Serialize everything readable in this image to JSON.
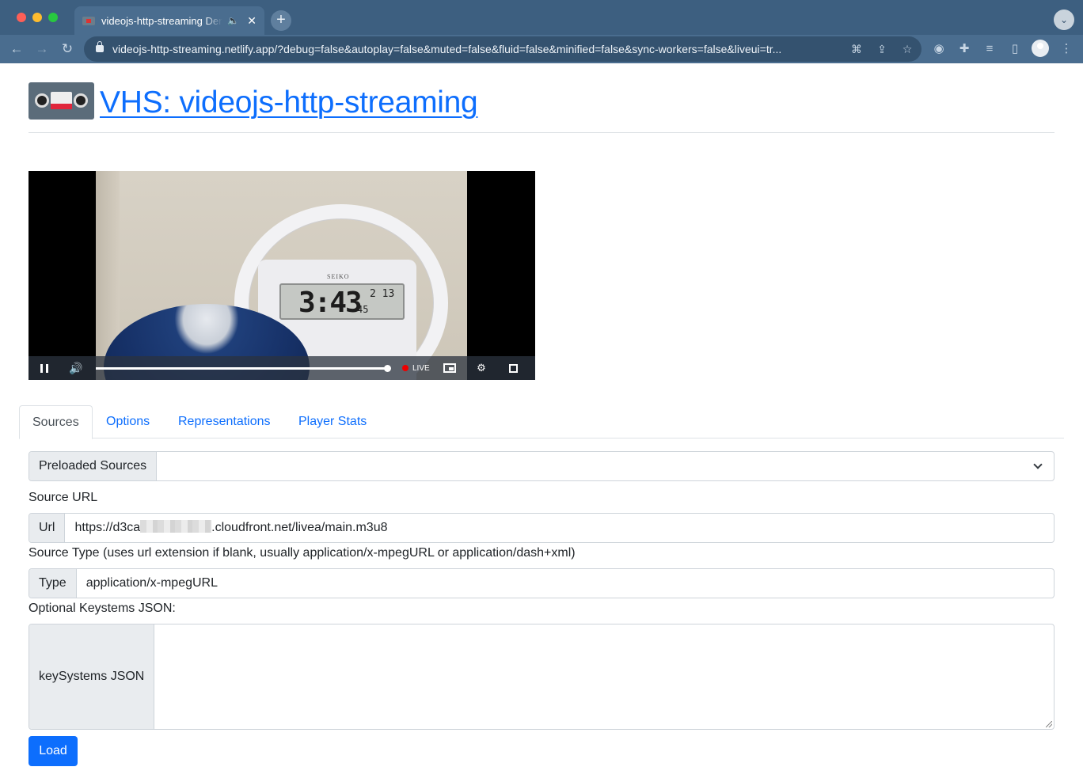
{
  "browser": {
    "tab_title": "videojs-http-streaming Demo",
    "tab_audio_icon": "speaker-icon",
    "tab_close_icon": "close-icon",
    "new_tab_icon": "plus-icon",
    "tab_menu_icon": "chevron-down-icon",
    "url": "videojs-http-streaming.netlify.app/?debug=false&autoplay=false&muted=false&fluid=false&minified=false&sync-workers=false&liveui=tr...",
    "back_icon": "arrow-left-icon",
    "forward_icon": "arrow-right-icon",
    "reload_icon": "reload-icon"
  },
  "header": {
    "title": "VHS: videojs-http-streaming",
    "logo_icon": "vhs-cassette-icon"
  },
  "player": {
    "clock_brand": "SEIKO",
    "clock_time": "3:43",
    "clock_seconds": "45",
    "clock_date": "2 13",
    "live_label": "LIVE",
    "progress_fraction": 0.99
  },
  "tabs": [
    {
      "label": "Sources",
      "active": true
    },
    {
      "label": "Options",
      "active": false
    },
    {
      "label": "Representations",
      "active": false
    },
    {
      "label": "Player Stats",
      "active": false
    }
  ],
  "form": {
    "preloaded_label": "Preloaded Sources",
    "preloaded_value": "",
    "source_url_heading": "Source URL",
    "url_label": "Url",
    "url_value_start": "https://d3ca",
    "url_value_end": ".cloudfront.net/livea/main.m3u8",
    "source_type_heading": "Source Type (uses url extension if blank, usually application/x-mpegURL or application/dash+xml)",
    "type_label": "Type",
    "type_value": "application/x-mpegURL",
    "keysystems_heading": "Optional Keystems JSON:",
    "keysystems_label": "keySystems JSON",
    "keysystems_value": "",
    "load_button": "Load"
  },
  "colors": {
    "primary": "#0d6efd",
    "chrome": "#4a6d8f",
    "live_dot": "#ee0000"
  }
}
